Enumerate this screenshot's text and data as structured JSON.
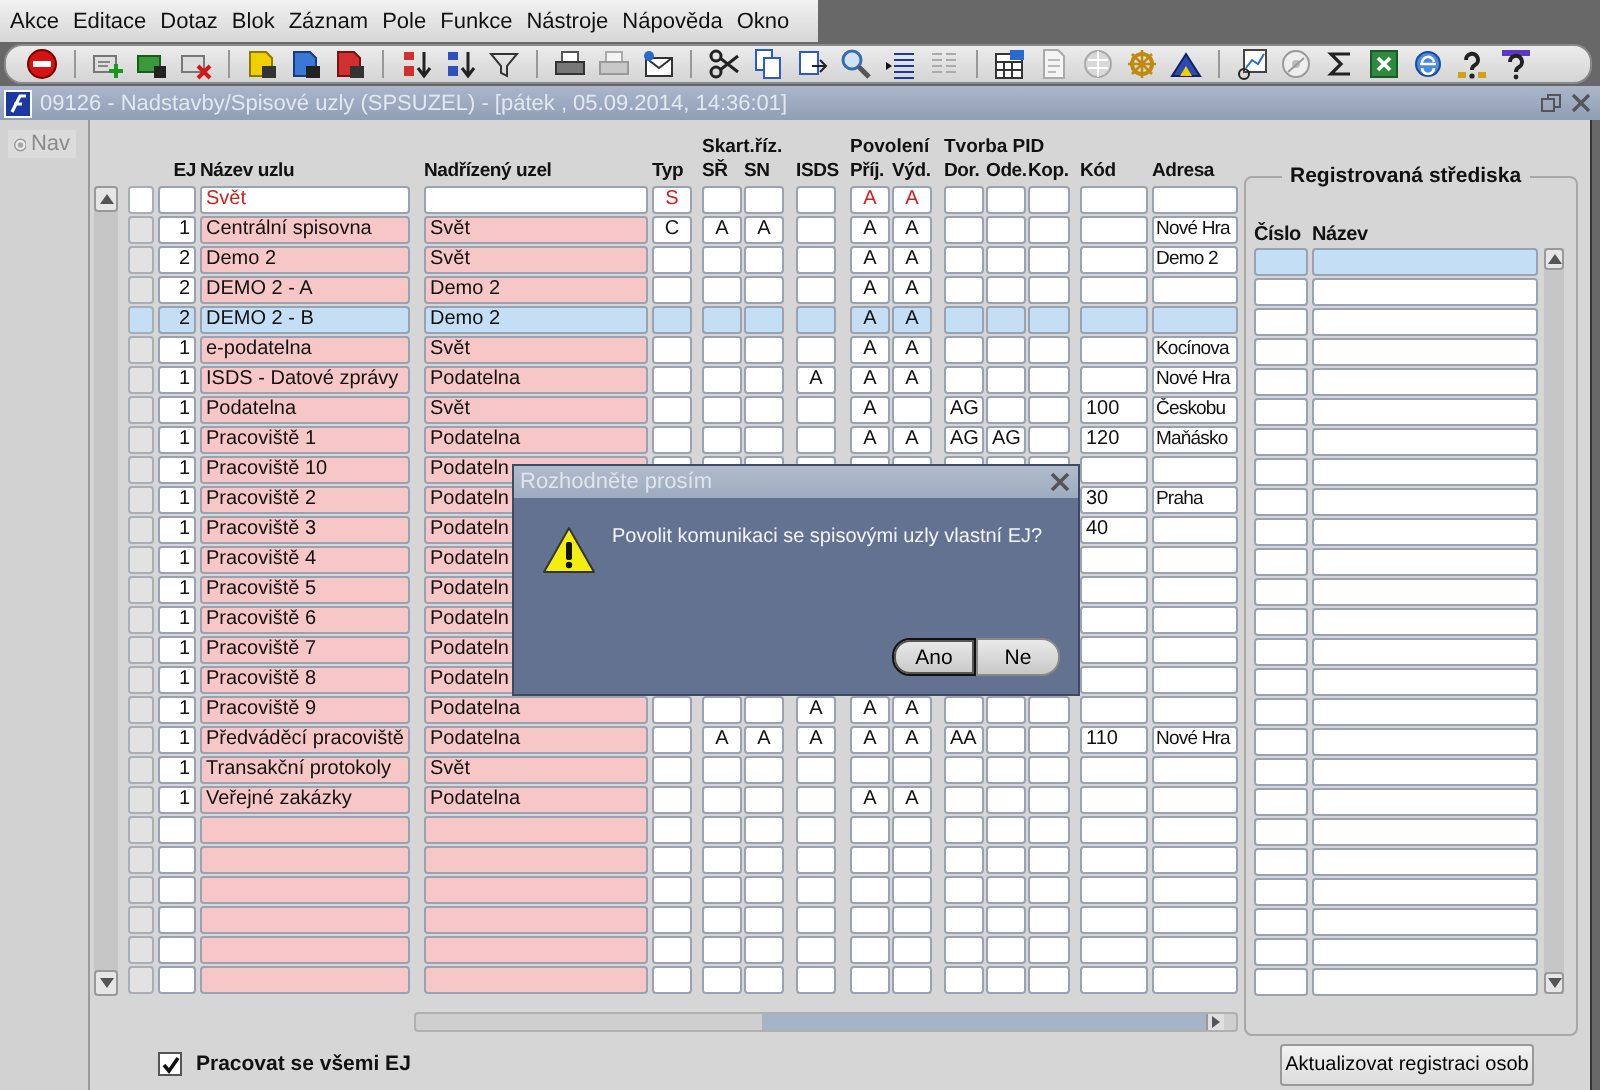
{
  "menu": [
    "Akce",
    "Editace",
    "Dotaz",
    "Blok",
    "Záznam",
    "Pole",
    "Funkce",
    "Nástroje",
    "Nápověda",
    "Okno"
  ],
  "window": {
    "title": "09126 - Nadstavby/Spisové uzly (SPSUZEL) - [pátek , 05.09.2014, 14:36:01]"
  },
  "nav": {
    "label": "Nav",
    "disabled": true
  },
  "table": {
    "column_groups": [
      {
        "columns": [
          {
            "label": "EJ"
          },
          {
            "label": "Název uzlu"
          },
          {
            "label": "Nadřízený uzel"
          },
          {
            "label": "Typ"
          }
        ]
      },
      {
        "label": "Skart.říz.",
        "columns": [
          {
            "label": "SŘ"
          },
          {
            "label": "SN"
          }
        ]
      },
      {
        "columns": [
          {
            "label": "ISDS"
          }
        ]
      },
      {
        "label": "Povolení",
        "columns": [
          {
            "label": "Příj."
          },
          {
            "label": "Výd."
          }
        ]
      },
      {
        "label": "Tvorba PID",
        "columns": [
          {
            "label": "Dor."
          },
          {
            "label": "Ode."
          },
          {
            "label": "Kop."
          }
        ]
      },
      {
        "columns": [
          {
            "label": "Kód"
          },
          {
            "label": "Adresa"
          }
        ]
      }
    ],
    "rows": [
      {
        "kind": "filter",
        "node_name": "Svět",
        "type": "S",
        "receive": "A",
        "send": "A"
      },
      {
        "kind": "record",
        "selected": false,
        "ej": "1",
        "node_name": "Centrální spisovna",
        "parent_node": "Svět",
        "type": "C",
        "sr": "A",
        "sn": "A",
        "receive": "A",
        "send": "A",
        "address": "Nové Hra"
      },
      {
        "kind": "record",
        "selected": false,
        "ej": "2",
        "node_name": "Demo 2",
        "parent_node": "Svět",
        "receive": "A",
        "send": "A",
        "address": "Demo 2"
      },
      {
        "kind": "record",
        "selected": false,
        "ej": "2",
        "node_name": "DEMO 2 - A",
        "parent_node": "Demo 2",
        "receive": "A",
        "send": "A"
      },
      {
        "kind": "record",
        "selected": true,
        "ej": "2",
        "node_name": "DEMO 2 - B",
        "parent_node": "Demo 2",
        "receive": "A",
        "send": "A"
      },
      {
        "kind": "record",
        "selected": false,
        "ej": "1",
        "node_name": "e-podatelna",
        "parent_node": "Svět",
        "receive": "A",
        "send": "A",
        "address": "Kocínova"
      },
      {
        "kind": "record",
        "selected": false,
        "ej": "1",
        "node_name": "ISDS - Datové zprávy",
        "parent_node": "Podatelna",
        "isds": "A",
        "receive": "A",
        "send": "A",
        "address": "Nové Hra"
      },
      {
        "kind": "record",
        "selected": false,
        "ej": "1",
        "node_name": "Podatelna",
        "parent_node": "Svět",
        "receive": "A",
        "dor": "AG",
        "code": "100",
        "address": "Českobu"
      },
      {
        "kind": "record",
        "selected": false,
        "ej": "1",
        "node_name": "Pracoviště 1",
        "parent_node": "Podatelna",
        "receive": "A",
        "send": "A",
        "dor": "AG",
        "ode": "AG",
        "code": "120",
        "address": "Maňásko"
      },
      {
        "kind": "record",
        "selected": false,
        "ej": "1",
        "node_name": "Pracoviště 10",
        "parent_node": "Podateln"
      },
      {
        "kind": "record",
        "selected": false,
        "ej": "1",
        "node_name": "Pracoviště 2",
        "parent_node": "Podateln",
        "code": "30",
        "address": "Praha"
      },
      {
        "kind": "record",
        "selected": false,
        "ej": "1",
        "node_name": "Pracoviště 3",
        "parent_node": "Podateln",
        "code": "40"
      },
      {
        "kind": "record",
        "selected": false,
        "ej": "1",
        "node_name": "Pracoviště 4",
        "parent_node": "Podateln"
      },
      {
        "kind": "record",
        "selected": false,
        "ej": "1",
        "node_name": "Pracoviště 5",
        "parent_node": "Podateln"
      },
      {
        "kind": "record",
        "selected": false,
        "ej": "1",
        "node_name": "Pracoviště 6",
        "parent_node": "Podateln"
      },
      {
        "kind": "record",
        "selected": false,
        "ej": "1",
        "node_name": "Pracoviště 7",
        "parent_node": "Podateln"
      },
      {
        "kind": "record",
        "selected": false,
        "ej": "1",
        "node_name": "Pracoviště 8",
        "parent_node": "Podateln"
      },
      {
        "kind": "record",
        "selected": false,
        "ej": "1",
        "node_name": "Pracoviště 9",
        "parent_node": "Podatelna",
        "isds": "A",
        "receive": "A",
        "send": "A"
      },
      {
        "kind": "record",
        "selected": false,
        "ej": "1",
        "node_name": "Předváděcí pracoviště",
        "parent_node": "Podatelna",
        "sr": "A",
        "sn": "A",
        "isds": "A",
        "receive": "A",
        "send": "A",
        "dor": "AA",
        "code": "110",
        "address": "Nové Hra"
      },
      {
        "kind": "record",
        "selected": false,
        "ej": "1",
        "node_name": "Transakční protokoly",
        "parent_node": "Svět"
      },
      {
        "kind": "record",
        "selected": false,
        "ej": "1",
        "node_name": "Veřejné zakázky",
        "parent_node": "Podatelna",
        "receive": "A",
        "send": "A"
      }
    ]
  },
  "registered_centers": {
    "title": "Registrovaná střediska",
    "columns": [
      {
        "label": "Číslo"
      },
      {
        "label": "Název"
      }
    ],
    "first_row_current": true
  },
  "all_units_checkbox": {
    "label": "Pracovat se všemi EJ",
    "checked": true
  },
  "update_button": {
    "label": "Aktualizovat registraci osob"
  },
  "dialog": {
    "title": "Rozhodněte prosím",
    "message": "Povolit komunikaci se spisovými uzly vlastní EJ?",
    "buttons": [
      {
        "label": "Ano",
        "focused": true
      },
      {
        "label": "Ne",
        "focused": false
      }
    ]
  }
}
